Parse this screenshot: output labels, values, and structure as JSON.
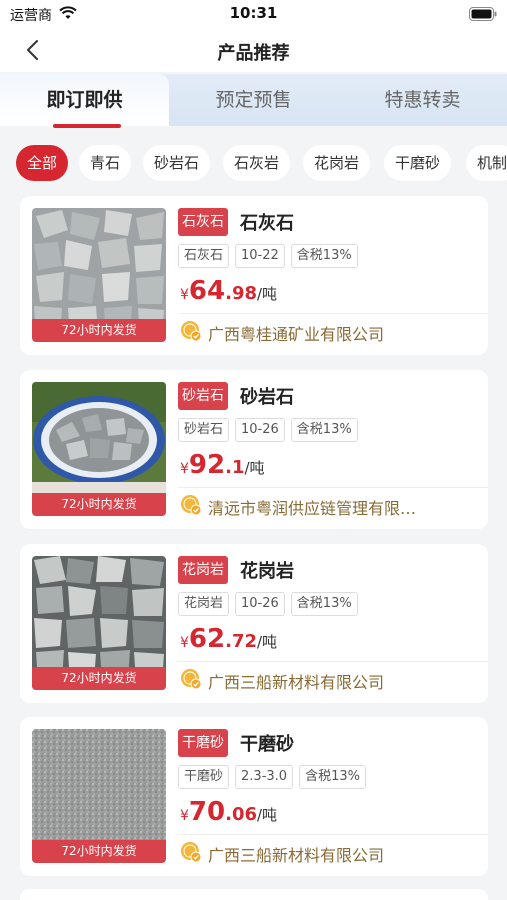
{
  "status_bar": {
    "carrier": "运营商",
    "time": "10:31"
  },
  "nav": {
    "title": "产品推荐"
  },
  "tabs": [
    {
      "label": "即订即供",
      "active": true
    },
    {
      "label": "预定预售",
      "active": false
    },
    {
      "label": "特惠转卖",
      "active": false
    }
  ],
  "filters": [
    {
      "label": "全部",
      "active": true
    },
    {
      "label": "青石",
      "active": false
    },
    {
      "label": "砂岩石",
      "active": false
    },
    {
      "label": "石灰岩",
      "active": false
    },
    {
      "label": "花岗岩",
      "active": false
    },
    {
      "label": "干磨砂",
      "active": false
    },
    {
      "label": "机制",
      "active": false
    }
  ],
  "products": [
    {
      "tag": "石灰石",
      "name": "石灰石",
      "specs": [
        "石灰石",
        "10-22",
        "含税13%"
      ],
      "currency": "¥",
      "price_int": "64",
      "price_dec": ".98",
      "unit": "/吨",
      "shipping": "72小时内发货",
      "company": "广西粤桂通矿业有限公司"
    },
    {
      "tag": "砂岩石",
      "name": "砂岩石",
      "specs": [
        "砂岩石",
        "10-26",
        "含税13%"
      ],
      "currency": "¥",
      "price_int": "92",
      "price_dec": ".1",
      "unit": "/吨",
      "shipping": "72小时内发货",
      "company": "清远市粤润供应链管理有限…"
    },
    {
      "tag": "花岗岩",
      "name": "花岗岩",
      "specs": [
        "花岗岩",
        "10-26",
        "含税13%"
      ],
      "currency": "¥",
      "price_int": "62",
      "price_dec": ".72",
      "unit": "/吨",
      "shipping": "72小时内发货",
      "company": "广西三船新材料有限公司"
    },
    {
      "tag": "干磨砂",
      "name": "干磨砂",
      "specs": [
        "干磨砂",
        "2.3-3.0",
        "含税13%"
      ],
      "currency": "¥",
      "price_int": "70",
      "price_dec": ".06",
      "unit": "/吨",
      "shipping": "72小时内发货",
      "company": "广西三船新材料有限公司"
    }
  ],
  "icons": {
    "back": "chevron-left-icon",
    "wifi": "wifi-icon",
    "battery": "battery-icon",
    "supplier": "gold-coin-check-icon"
  },
  "colors": {
    "accent": "#d6262f",
    "company_text": "#8a6a34",
    "background": "#f3f4f6"
  }
}
